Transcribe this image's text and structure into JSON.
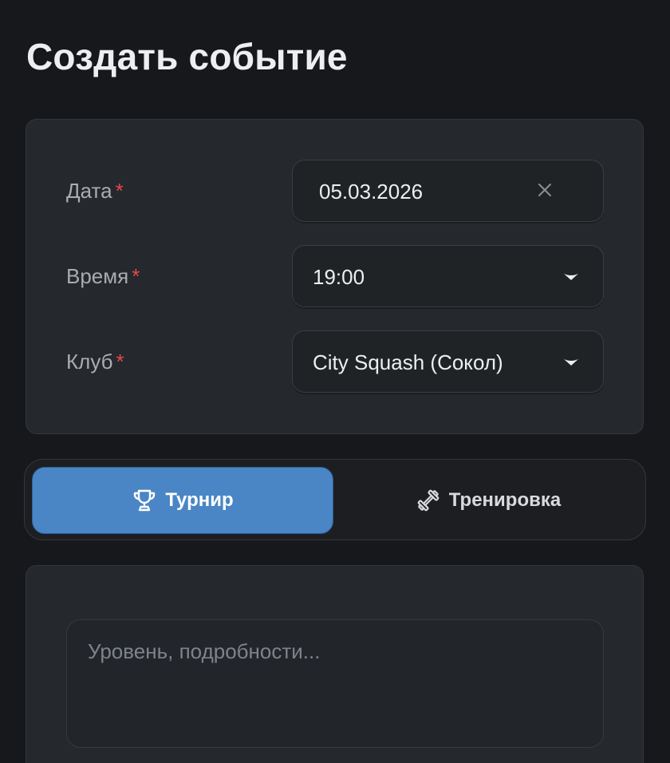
{
  "title": "Создать событие",
  "form": {
    "date": {
      "label": "Дата",
      "required_mark": "*",
      "value": "05.03.2026",
      "clear_icon": "close-icon"
    },
    "time": {
      "label": "Время",
      "required_mark": "*",
      "value": "19:00",
      "dropdown_icon": "chevron-down-icon"
    },
    "club": {
      "label": "Клуб",
      "required_mark": "*",
      "value": "City Squash (Сокол)",
      "dropdown_icon": "chevron-down-icon"
    }
  },
  "event_type": {
    "options": [
      {
        "label": "Турнир",
        "icon": "trophy-icon",
        "selected": true
      },
      {
        "label": "Тренировка",
        "icon": "dumbbell-icon",
        "selected": false
      }
    ]
  },
  "notes": {
    "placeholder": "Уровень, подробности...",
    "value": ""
  },
  "colors": {
    "background": "#17181c",
    "card": "#25282c",
    "accent": "#4a86c5",
    "required": "#e5484d"
  }
}
